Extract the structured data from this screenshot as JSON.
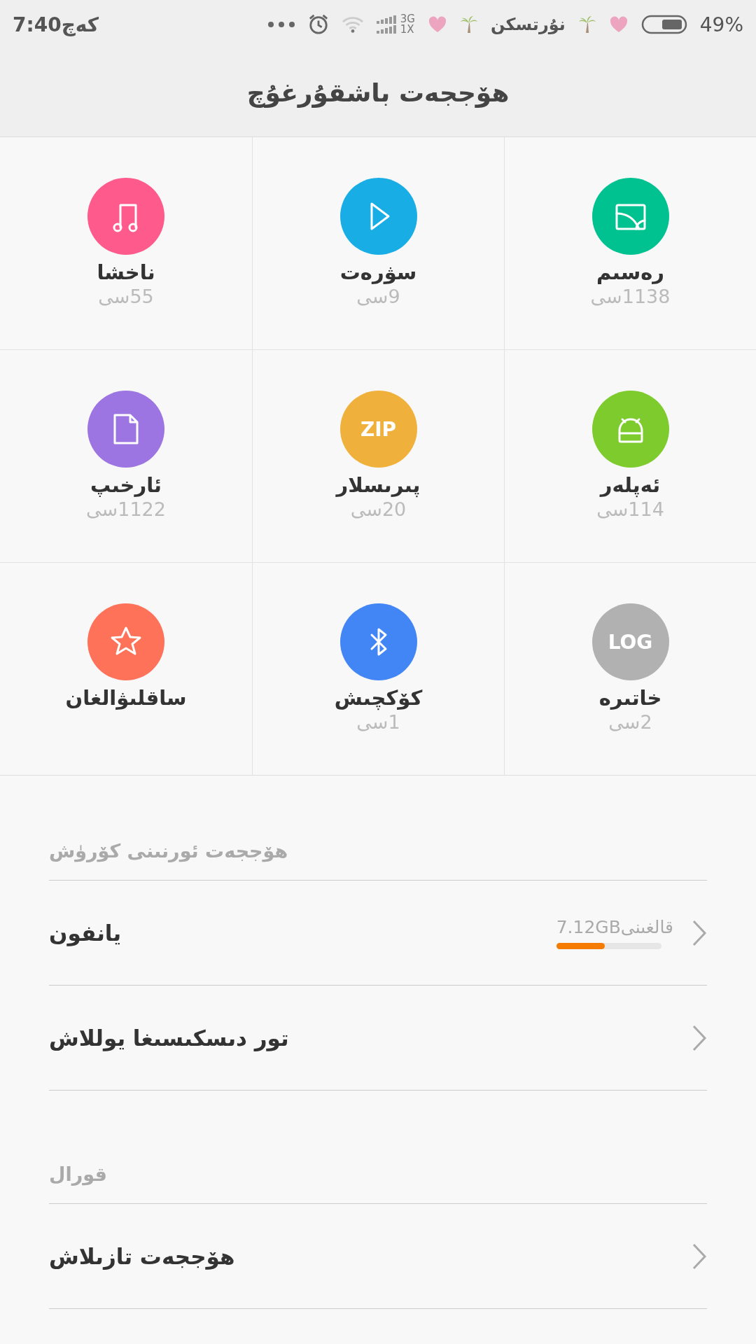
{
  "status_bar": {
    "time": "كەچ7:40",
    "network_top": "3G",
    "network_bottom": "1X",
    "carrier": "نۇرتسكن",
    "battery": "49%"
  },
  "header": {
    "title": "هۆججەت باشقۇرغۇچ"
  },
  "categories": [
    {
      "kind": "image",
      "label": "رەسىم",
      "count": "1138سى",
      "color": "#00c190"
    },
    {
      "kind": "video",
      "label": "سۋرەت",
      "count": "9سى",
      "color": "#19ade6"
    },
    {
      "kind": "music",
      "label": "ناخشا",
      "count": "55سى",
      "color": "#ff5a8c"
    },
    {
      "kind": "apk",
      "label": "ئەپلەر",
      "count": "114سى",
      "color": "#7dcb2c"
    },
    {
      "kind": "zip",
      "label": "پىرىسلار",
      "count": "20سى",
      "color": "#f0b13c",
      "icon_text": "ZIP"
    },
    {
      "kind": "document",
      "label": "ئارخىپ",
      "count": "1122سى",
      "color": "#9d75e2"
    },
    {
      "kind": "log",
      "label": "خاتىرە",
      "count": "2سى",
      "color": "#b1b1b1",
      "icon_text": "LOG"
    },
    {
      "kind": "bluetooth",
      "label": "كۆكچىش",
      "count": "1سى",
      "color": "#4286f5"
    },
    {
      "kind": "favorite",
      "label": "ساقلىۋالغان",
      "color": "#ff725a"
    }
  ],
  "sections": [
    {
      "title": "هۆججەت ئورنىنى كۆرۈش",
      "items": [
        {
          "label": "يانفون",
          "detail": "قالغىنى7.12GB",
          "level": 0.46
        },
        {
          "label": "تور دىسكىسىغا يوللاش"
        }
      ]
    },
    {
      "title": "قورال",
      "items": [
        {
          "label": "هۆججەت تازىلاش"
        }
      ]
    }
  ]
}
